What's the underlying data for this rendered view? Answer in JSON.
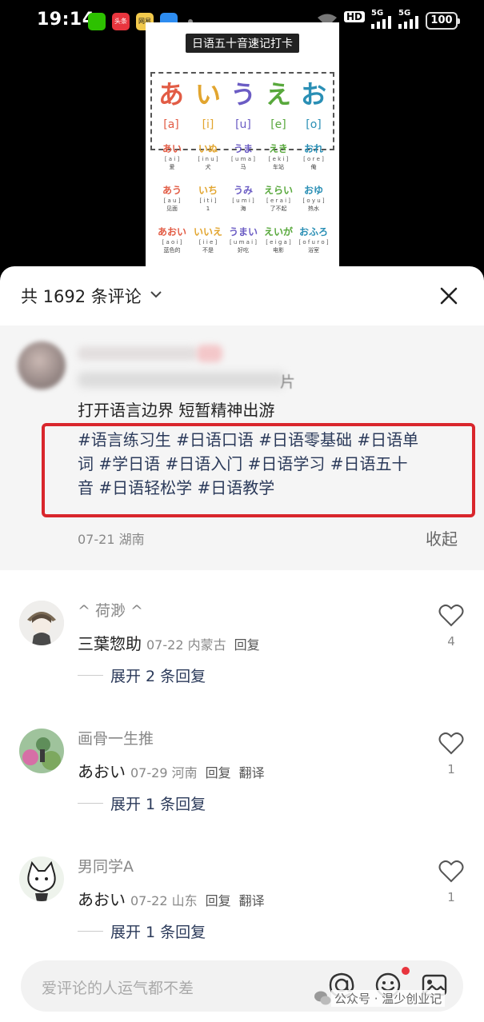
{
  "status_bar": {
    "time": "19:14",
    "apps": [
      {
        "icon": "wechat-icon",
        "color": "#2dc100",
        "label": ""
      },
      {
        "icon": "toutiao-icon",
        "color": "#e8353e",
        "label": "头条"
      },
      {
        "icon": "app-icon",
        "color": "#f2c94c",
        "label": "网易"
      },
      {
        "icon": "cloud-icon",
        "color": "#2d8cf0",
        "label": ""
      }
    ],
    "hd": "HD",
    "net1": "5G",
    "net2": "5G",
    "battery": "100"
  },
  "video_card": {
    "title": "日语五十音速记打卡",
    "vowels": [
      {
        "kana": "あ",
        "romaji": "[a]",
        "color": "#e25c45"
      },
      {
        "kana": "い",
        "romaji": "[i]",
        "color": "#e2a52f"
      },
      {
        "kana": "う",
        "romaji": "[u]",
        "color": "#6b5cc4"
      },
      {
        "kana": "え",
        "romaji": "[e]",
        "color": "#58a83c"
      },
      {
        "kana": "お",
        "romaji": "[o]",
        "color": "#2a8fb5"
      }
    ],
    "words": [
      [
        {
          "kana": "あい",
          "romaji": "[ a i ]",
          "meaning": "爱"
        },
        {
          "kana": "いぬ",
          "romaji": "[ i n u ]",
          "meaning": "犬"
        },
        {
          "kana": "うま",
          "romaji": "[ u m a ]",
          "meaning": "马"
        },
        {
          "kana": "えき",
          "romaji": "[ e k i ]",
          "meaning": "车站"
        },
        {
          "kana": "おれ",
          "romaji": "[ o r e ]",
          "meaning": "俺"
        }
      ],
      [
        {
          "kana": "あう",
          "romaji": "[ a u ]",
          "meaning": "见面"
        },
        {
          "kana": "いち",
          "romaji": "[ i t i ]",
          "meaning": "1"
        },
        {
          "kana": "うみ",
          "romaji": "[ u m i ]",
          "meaning": "海"
        },
        {
          "kana": "えらい",
          "romaji": "[ e r a i ]",
          "meaning": "了不起"
        },
        {
          "kana": "おゆ",
          "romaji": "[ o y u ]",
          "meaning": "热水"
        }
      ],
      [
        {
          "kana": "あおい",
          "romaji": "[ a o i ]",
          "meaning": "蓝色的"
        },
        {
          "kana": "いいえ",
          "romaji": "[ i i e ]",
          "meaning": "不是"
        },
        {
          "kana": "うまい",
          "romaji": "[ u m a i ]",
          "meaning": "好吃"
        },
        {
          "kana": "えいが",
          "romaji": "[ e i g a ]",
          "meaning": "电影"
        },
        {
          "kana": "おふろ",
          "romaji": "[ o f u r o ]",
          "meaning": "浴室"
        }
      ]
    ]
  },
  "header": {
    "comment_count": "共 1692 条评论"
  },
  "expanded_post": {
    "partial_text": "片",
    "text": "打开语言边界 短暂精神出游",
    "hashtags_line1": "#语言练习生 #日语口语 #日语零基础 #日语单",
    "hashtags_line2": "词 #学日语 #日语入门 #日语学习 #日语五十",
    "hashtags_line3": "音 #日语轻松学 #日语教学",
    "meta": "07-21 湖南",
    "collapse": "收起",
    "highlight_color": "#d9262c"
  },
  "comments": [
    {
      "name": "^ 荷渺 ^",
      "text": "三葉惣助",
      "meta": "07-22 内蒙古",
      "reply": "回复",
      "translate": "",
      "likes": "4",
      "expand": "展开 2 条回复"
    },
    {
      "name": "画骨一生推",
      "text": "あおい",
      "meta": "07-29 河南",
      "reply": "回复",
      "translate": "翻译",
      "likes": "1",
      "expand": "展开 1 条回复"
    },
    {
      "name": "男同学A",
      "text": "あおい",
      "meta": "07-22 山东",
      "reply": "回复",
      "translate": "翻译",
      "likes": "1",
      "expand": "展开 1 条回复"
    }
  ],
  "input": {
    "placeholder": "爱评论的人运气都不差"
  },
  "watermark": "公众号 · 温少创业记"
}
